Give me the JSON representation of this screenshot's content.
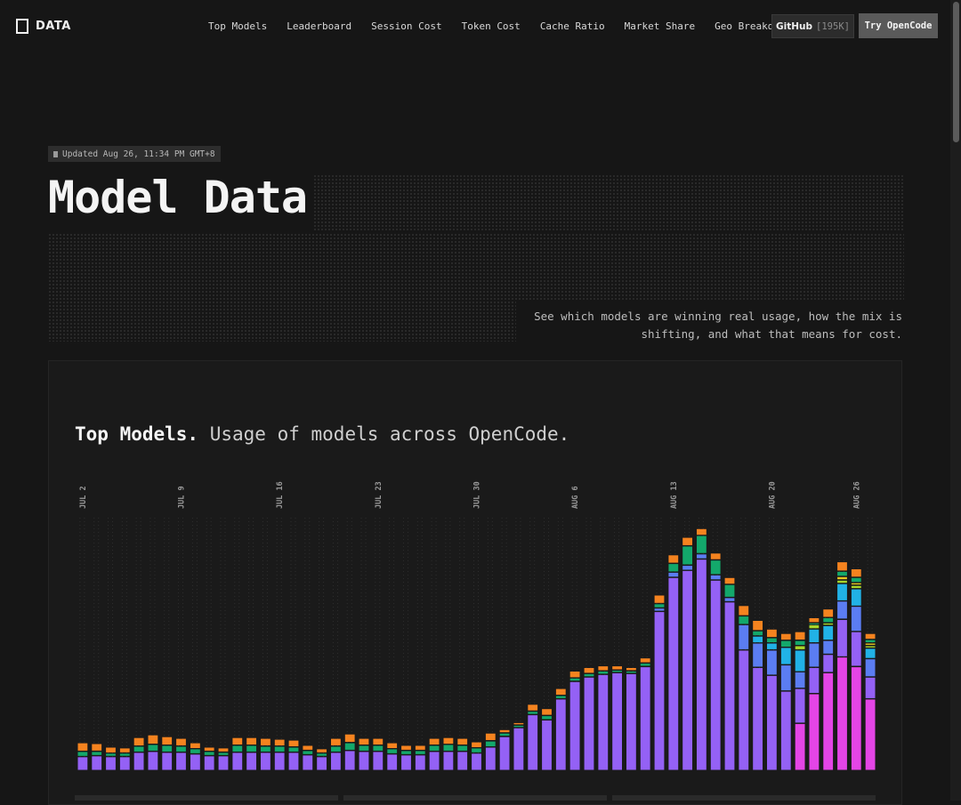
{
  "header": {
    "logo_text": "DATA",
    "nav": [
      "Top Models",
      "Leaderboard",
      "Session Cost",
      "Token Cost",
      "Cache Ratio",
      "Market Share",
      "Geo Breakdown"
    ],
    "github_label": "GitHub",
    "github_stars": "[195K]",
    "try_label": "Try OpenCode"
  },
  "hero": {
    "updated": "Updated Aug 26, 11:34 PM GMT+8",
    "title": "Model Data",
    "subtitle_line1": "See which models are winning real usage, how the mix is",
    "subtitle_line2": "shifting, and what that means for cost."
  },
  "panel": {
    "heading_bold": "Top Models.",
    "heading_rest": " Usage of models across OpenCode."
  },
  "colors": {
    "purple": "#9461f5",
    "green": "#13a86b",
    "orange": "#f5831f",
    "blue": "#5b7df2",
    "cyan": "#21b2e6",
    "magenta": "#e445e6",
    "lime": "#a8d62a",
    "yellow": "#e8c81f"
  },
  "chart_data": {
    "type": "bar",
    "stacked": true,
    "x_ticks": [
      "JUL 2",
      "JUL 9",
      "JUL 16",
      "JUL 23",
      "JUL 30",
      "AUG 6",
      "AUG 13",
      "AUG 20",
      "AUG 26"
    ],
    "x_tick_indices": [
      0,
      7,
      14,
      21,
      28,
      35,
      42,
      49,
      55
    ],
    "grid": true,
    "legend": "none",
    "ylim": [
      0,
      290
    ],
    "bars": [
      [
        {
          "c": "purple",
          "v": 16
        },
        {
          "c": "green",
          "v": 6
        },
        {
          "c": "orange",
          "v": 10
        }
      ],
      [
        {
          "c": "purple",
          "v": 17
        },
        {
          "c": "green",
          "v": 5
        },
        {
          "c": "orange",
          "v": 9
        }
      ],
      [
        {
          "c": "purple",
          "v": 16
        },
        {
          "c": "green",
          "v": 4
        },
        {
          "c": "orange",
          "v": 7
        }
      ],
      [
        {
          "c": "purple",
          "v": 16
        },
        {
          "c": "green",
          "v": 4
        },
        {
          "c": "orange",
          "v": 6
        }
      ],
      [
        {
          "c": "purple",
          "v": 21
        },
        {
          "c": "green",
          "v": 7
        },
        {
          "c": "orange",
          "v": 10
        }
      ],
      [
        {
          "c": "purple",
          "v": 22
        },
        {
          "c": "green",
          "v": 8
        },
        {
          "c": "orange",
          "v": 11
        }
      ],
      [
        {
          "c": "purple",
          "v": 21
        },
        {
          "c": "green",
          "v": 8
        },
        {
          "c": "orange",
          "v": 10
        }
      ],
      [
        {
          "c": "purple",
          "v": 21
        },
        {
          "c": "green",
          "v": 7
        },
        {
          "c": "orange",
          "v": 9
        }
      ],
      [
        {
          "c": "purple",
          "v": 19
        },
        {
          "c": "green",
          "v": 6
        },
        {
          "c": "orange",
          "v": 7
        }
      ],
      [
        {
          "c": "purple",
          "v": 17
        },
        {
          "c": "green",
          "v": 5
        },
        {
          "c": "orange",
          "v": 5
        }
      ],
      [
        {
          "c": "purple",
          "v": 17
        },
        {
          "c": "green",
          "v": 4
        },
        {
          "c": "orange",
          "v": 5
        }
      ],
      [
        {
          "c": "purple",
          "v": 21
        },
        {
          "c": "green",
          "v": 8
        },
        {
          "c": "orange",
          "v": 9
        }
      ],
      [
        {
          "c": "purple",
          "v": 21
        },
        {
          "c": "green",
          "v": 8
        },
        {
          "c": "orange",
          "v": 9
        }
      ],
      [
        {
          "c": "purple",
          "v": 21
        },
        {
          "c": "green",
          "v": 7
        },
        {
          "c": "orange",
          "v": 9
        }
      ],
      [
        {
          "c": "purple",
          "v": 21
        },
        {
          "c": "green",
          "v": 7
        },
        {
          "c": "orange",
          "v": 8
        }
      ],
      [
        {
          "c": "purple",
          "v": 21
        },
        {
          "c": "green",
          "v": 6
        },
        {
          "c": "orange",
          "v": 8
        }
      ],
      [
        {
          "c": "purple",
          "v": 18
        },
        {
          "c": "green",
          "v": 5
        },
        {
          "c": "orange",
          "v": 6
        }
      ],
      [
        {
          "c": "purple",
          "v": 16
        },
        {
          "c": "green",
          "v": 4
        },
        {
          "c": "orange",
          "v": 5
        }
      ],
      [
        {
          "c": "purple",
          "v": 21
        },
        {
          "c": "green",
          "v": 7
        },
        {
          "c": "orange",
          "v": 9
        }
      ],
      [
        {
          "c": "purple",
          "v": 23
        },
        {
          "c": "green",
          "v": 9
        },
        {
          "c": "orange",
          "v": 10
        }
      ],
      [
        {
          "c": "purple",
          "v": 22
        },
        {
          "c": "green",
          "v": 7
        },
        {
          "c": "orange",
          "v": 8
        }
      ],
      [
        {
          "c": "purple",
          "v": 22
        },
        {
          "c": "green",
          "v": 7
        },
        {
          "c": "orange",
          "v": 8
        }
      ],
      [
        {
          "c": "purple",
          "v": 19
        },
        {
          "c": "green",
          "v": 6
        },
        {
          "c": "orange",
          "v": 7
        }
      ],
      [
        {
          "c": "purple",
          "v": 18
        },
        {
          "c": "green",
          "v": 5
        },
        {
          "c": "orange",
          "v": 6
        }
      ],
      [
        {
          "c": "purple",
          "v": 18
        },
        {
          "c": "green",
          "v": 5
        },
        {
          "c": "orange",
          "v": 6
        }
      ],
      [
        {
          "c": "purple",
          "v": 22
        },
        {
          "c": "green",
          "v": 7
        },
        {
          "c": "orange",
          "v": 8
        }
      ],
      [
        {
          "c": "purple",
          "v": 22
        },
        {
          "c": "green",
          "v": 8
        },
        {
          "c": "orange",
          "v": 8
        }
      ],
      [
        {
          "c": "purple",
          "v": 22
        },
        {
          "c": "green",
          "v": 7
        },
        {
          "c": "orange",
          "v": 8
        }
      ],
      [
        {
          "c": "purple",
          "v": 20
        },
        {
          "c": "green",
          "v": 6
        },
        {
          "c": "orange",
          "v": 7
        }
      ],
      [
        {
          "c": "purple",
          "v": 27
        },
        {
          "c": "green",
          "v": 7
        },
        {
          "c": "orange",
          "v": 9
        }
      ],
      [
        {
          "c": "purple",
          "v": 39
        },
        {
          "c": "green",
          "v": 4
        },
        {
          "c": "orange",
          "v": 4
        }
      ],
      [
        {
          "c": "purple",
          "v": 49
        },
        {
          "c": "green",
          "v": 3
        },
        {
          "c": "orange",
          "v": 3
        }
      ],
      [
        {
          "c": "purple",
          "v": 64
        },
        {
          "c": "green",
          "v": 4
        },
        {
          "c": "orange",
          "v": 8
        }
      ],
      [
        {
          "c": "purple",
          "v": 58
        },
        {
          "c": "green",
          "v": 5
        },
        {
          "c": "orange",
          "v": 8
        }
      ],
      [
        {
          "c": "purple",
          "v": 82
        },
        {
          "c": "green",
          "v": 4
        },
        {
          "c": "orange",
          "v": 8
        }
      ],
      [
        {
          "c": "purple",
          "v": 102
        },
        {
          "c": "green",
          "v": 4
        },
        {
          "c": "orange",
          "v": 8
        }
      ],
      [
        {
          "c": "purple",
          "v": 107
        },
        {
          "c": "green",
          "v": 4
        },
        {
          "c": "orange",
          "v": 7
        }
      ],
      [
        {
          "c": "purple",
          "v": 110
        },
        {
          "c": "green",
          "v": 4
        },
        {
          "c": "orange",
          "v": 6
        }
      ],
      [
        {
          "c": "purple",
          "v": 112
        },
        {
          "c": "green",
          "v": 3
        },
        {
          "c": "orange",
          "v": 5
        }
      ],
      [
        {
          "c": "purple",
          "v": 111
        },
        {
          "c": "green",
          "v": 3
        },
        {
          "c": "orange",
          "v": 4
        }
      ],
      [
        {
          "c": "purple",
          "v": 119
        },
        {
          "c": "green",
          "v": 4
        },
        {
          "c": "orange",
          "v": 6
        }
      ],
      [
        {
          "c": "purple",
          "v": 182
        },
        {
          "c": "blue",
          "v": 4
        },
        {
          "c": "green",
          "v": 5
        },
        {
          "c": "orange",
          "v": 10
        }
      ],
      [
        {
          "c": "purple",
          "v": 221
        },
        {
          "c": "blue",
          "v": 6
        },
        {
          "c": "green",
          "v": 10
        },
        {
          "c": "orange",
          "v": 10
        }
      ],
      [
        {
          "c": "purple",
          "v": 229
        },
        {
          "c": "blue",
          "v": 6
        },
        {
          "c": "green",
          "v": 22
        },
        {
          "c": "orange",
          "v": 10
        }
      ],
      [
        {
          "c": "purple",
          "v": 242
        },
        {
          "c": "blue",
          "v": 6
        },
        {
          "c": "green",
          "v": 21
        },
        {
          "c": "orange",
          "v": 8
        }
      ],
      [
        {
          "c": "purple",
          "v": 218
        },
        {
          "c": "blue",
          "v": 6
        },
        {
          "c": "green",
          "v": 17
        },
        {
          "c": "orange",
          "v": 8
        }
      ],
      [
        {
          "c": "purple",
          "v": 193
        },
        {
          "c": "blue",
          "v": 5
        },
        {
          "c": "green",
          "v": 15
        },
        {
          "c": "orange",
          "v": 8
        }
      ],
      [
        {
          "c": "purple",
          "v": 138
        },
        {
          "c": "blue",
          "v": 29
        },
        {
          "c": "green",
          "v": 10
        },
        {
          "c": "orange",
          "v": 12
        }
      ],
      [
        {
          "c": "purple",
          "v": 118
        },
        {
          "c": "blue",
          "v": 28
        },
        {
          "c": "cyan",
          "v": 8
        },
        {
          "c": "green",
          "v": 6
        },
        {
          "c": "orange",
          "v": 12
        }
      ],
      [
        {
          "c": "purple",
          "v": 109
        },
        {
          "c": "blue",
          "v": 29
        },
        {
          "c": "cyan",
          "v": 8
        },
        {
          "c": "green",
          "v": 6
        },
        {
          "c": "orange",
          "v": 10
        }
      ],
      [
        {
          "c": "purple",
          "v": 91
        },
        {
          "c": "blue",
          "v": 30
        },
        {
          "c": "cyan",
          "v": 20
        },
        {
          "c": "green",
          "v": 8
        },
        {
          "c": "orange",
          "v": 8
        }
      ],
      [
        {
          "c": "magenta",
          "v": 54
        },
        {
          "c": "purple",
          "v": 40
        },
        {
          "c": "blue",
          "v": 19
        },
        {
          "c": "cyan",
          "v": 25
        },
        {
          "c": "lime",
          "v": 5
        },
        {
          "c": "green",
          "v": 6
        },
        {
          "c": "orange",
          "v": 10
        }
      ],
      [
        {
          "c": "magenta",
          "v": 88
        },
        {
          "c": "purple",
          "v": 30
        },
        {
          "c": "blue",
          "v": 28
        },
        {
          "c": "cyan",
          "v": 16
        },
        {
          "c": "lime",
          "v": 5
        },
        {
          "c": "green",
          "v": 2
        },
        {
          "c": "orange",
          "v": 6
        }
      ],
      [
        {
          "c": "magenta",
          "v": 112
        },
        {
          "c": "purple",
          "v": 21
        },
        {
          "c": "blue",
          "v": 16
        },
        {
          "c": "cyan",
          "v": 17
        },
        {
          "c": "lime",
          "v": 3
        },
        {
          "c": "green",
          "v": 6
        },
        {
          "c": "orange",
          "v": 10
        }
      ],
      [
        {
          "c": "magenta",
          "v": 130
        },
        {
          "c": "purple",
          "v": 43
        },
        {
          "c": "blue",
          "v": 21
        },
        {
          "c": "cyan",
          "v": 20
        },
        {
          "c": "lime",
          "v": 4
        },
        {
          "c": "yellow",
          "v": 4
        },
        {
          "c": "green",
          "v": 6
        },
        {
          "c": "orange",
          "v": 11
        }
      ],
      [
        {
          "c": "magenta",
          "v": 119
        },
        {
          "c": "purple",
          "v": 40
        },
        {
          "c": "blue",
          "v": 29
        },
        {
          "c": "cyan",
          "v": 20
        },
        {
          "c": "lime",
          "v": 4
        },
        {
          "c": "yellow",
          "v": 3
        },
        {
          "c": "green",
          "v": 6
        },
        {
          "c": "orange",
          "v": 10
        }
      ],
      [
        {
          "c": "magenta",
          "v": 82
        },
        {
          "c": "purple",
          "v": 25
        },
        {
          "c": "blue",
          "v": 21
        },
        {
          "c": "cyan",
          "v": 12
        },
        {
          "c": "lime",
          "v": 3
        },
        {
          "c": "yellow",
          "v": 3
        },
        {
          "c": "green",
          "v": 4
        },
        {
          "c": "orange",
          "v": 7
        }
      ]
    ]
  }
}
